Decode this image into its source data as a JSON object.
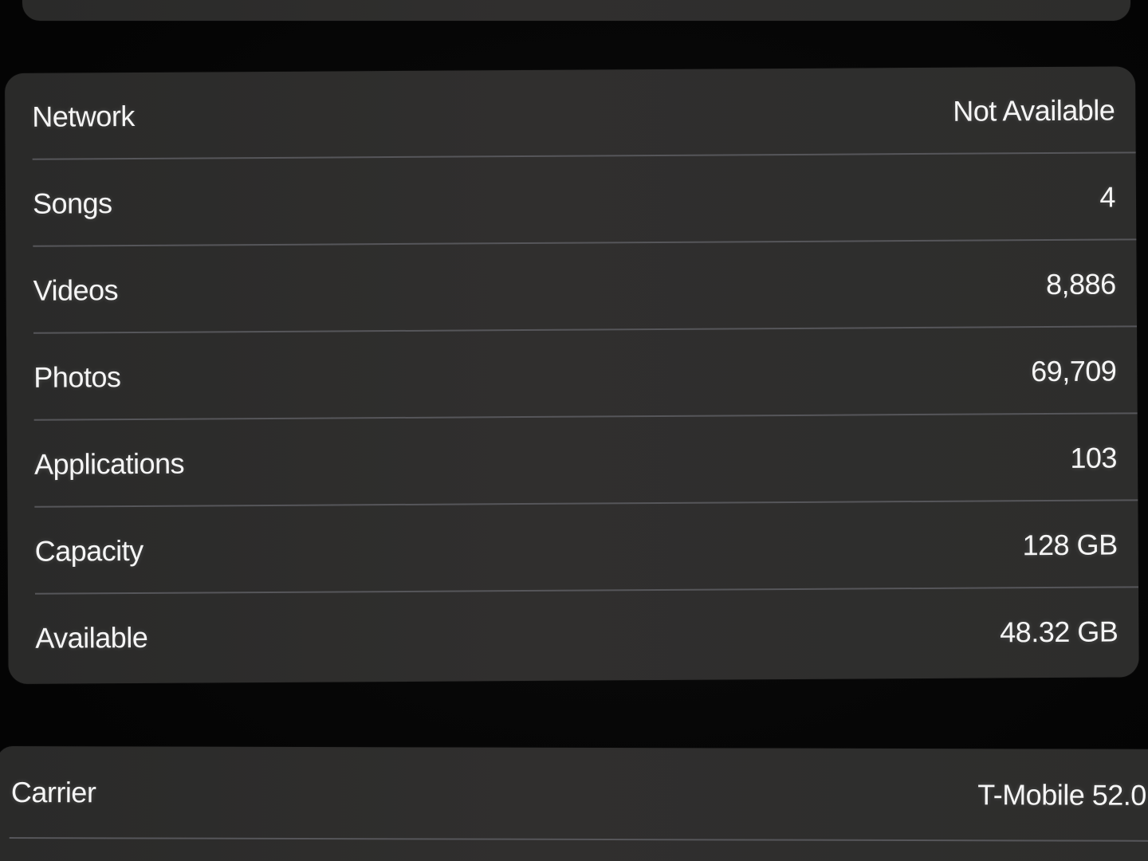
{
  "info_rows": [
    {
      "label": "Network",
      "value": "Not Available"
    },
    {
      "label": "Songs",
      "value": "4"
    },
    {
      "label": "Videos",
      "value": "8,886"
    },
    {
      "label": "Photos",
      "value": "69,709"
    },
    {
      "label": "Applications",
      "value": "103"
    },
    {
      "label": "Capacity",
      "value": "128 GB"
    },
    {
      "label": "Available",
      "value": "48.32 GB"
    }
  ],
  "carrier_row": {
    "label": "Carrier",
    "value": "T-Mobile 52.0"
  },
  "colors": {
    "background": "#060606",
    "group_background": "#2d2d2c",
    "separator": "#56565a",
    "text": "#f5f5f5"
  }
}
